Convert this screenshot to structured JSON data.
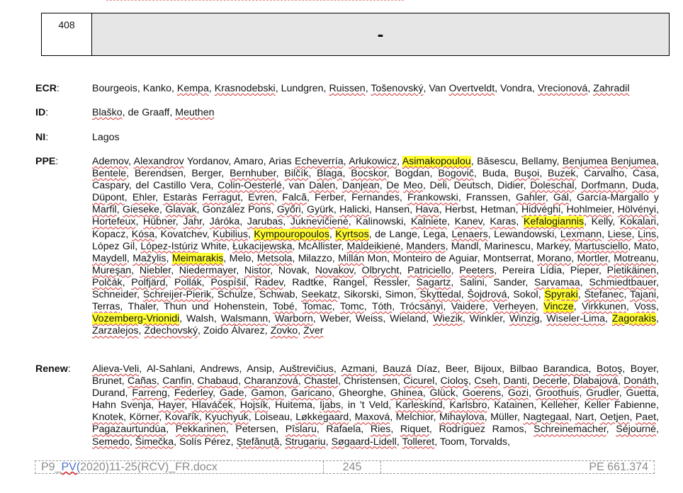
{
  "vote": {
    "number": "408",
    "result": "-"
  },
  "groups": [
    {
      "key": "ecr",
      "label": "ECR",
      "colon": ":",
      "names": "Bourgeois, Kanko, Kempa, Krasnodebski, Lundgren, Ruissen, Tošenovský, Van Overtveldt, Vondra, Vrecionová, Zahradil"
    },
    {
      "key": "id",
      "label": "ID",
      "colon": ":",
      "names": "Blaško, de Graaff, Meuthen"
    },
    {
      "key": "ni",
      "label": "NI",
      "colon": ":",
      "names": "Lagos"
    },
    {
      "key": "ppe",
      "label": "PPE",
      "colon": ":",
      "names": "Ademov, Alexandrov Yordanov, Amaro, Arias Echeverría, Arłukowicz, Asimakopoulou, Băsescu, Bellamy, Benjumea Benjumea, Bentele, Berendsen, Berger, Bernhuber, Bilčík, Blaga, Bocskor, Bogdan, Bogovič, Buda, Buşoi, Buzek, Carvalho, Casa, Caspary, del Castillo Vera, Colin-Oesterlé, van Dalen, Danjean, De Meo, Deli, Deutsch, Didier, Doleschal, Dorfmann, Duda, Düpont, Ehler, Estaràs Ferragut, Evren, Falcă, Ferber, Fernandes, Frankowski, Franssen, Gahler, Gál, García-Margallo y Marfil, Gieseke, Glavak, González Pons, Győri, Gyürk, Halicki, Hansen, Hava, Herbst, Hetman, Hidvéghi, Hohlmeier, Hölvényi, Hortefeux, Hübner, Jahr, Járóka, Jarubas, Juknevičienė, Kalinowski, Kalniete, Kanev, Karas, Kefalogiannis, Kelly, Kokalari, Kopacz, Kósa, Kovatchev, Kubilius, Kympouropoulos, Kyrtsos, de Lange, Lega, Lenaers, Lewandowski, Lexmann, Liese, Lins, López Gil, López-Istúriz White, Łukacijewska, McAllister, Maldeikienė, Manders, Mandl, Marinescu, Markey, Martusciello, Mato, Maydell, Mažylis, Meimarakis, Melo, Metsola, Milazzo, Millán Mon, Monteiro de Aguiar, Montserrat, Morano, Mortler, Motreanu, Mureşan, Niebler, Niedermayer, Nistor, Novak, Novakov, Olbrycht, Patriciello, Peeters, Pereira Lídia, Pieper, Pietikäinen, Polčák, Polfjärd, Pollák, Pospíšil, Radev, Radtke, Rangel, Ressler, Sagartz, Salini, Sander, Sarvamaa, Schmiedtbauer, Schneider, Schreijer-Pierik, Schulze, Schwab, Seekatz, Sikorski, Simon, Skyttedal, Šojdrová, Sokol, Spyraki, Štefanec, Tajani, Terras, Thaler, Thun und Hohenstein, Tobé, Tomac, Tomc, Tóth, Trócsányi, Vaidere, Verheyen, Vincze, Virkkunen, Voss, Vozemberg-Vrionidi, Walsh, Walsmann, Warborn, Weber, Weiss, Wieland, Wiezik, Winkler, Winzig, Wiseler-Lima, Zagorakis, Zarzalejos, Zdechovský, Zoido Álvarez, Zovko, Zver"
    },
    {
      "key": "renew",
      "label": "Renew",
      "colon": ":",
      "names": "Alieva-Veli, Al-Sahlani, Andrews, Ansip, Auštrevičius, Azmani, Bauzá Díaz, Beer, Bijoux, Bilbao Barandica, Botoş, Boyer, Brunet, Cañas, Canfin, Chabaud, Charanzová, Chastel, Christensen, Cicurel, Cioloş, Cseh, Danti, Decerle, Dlabajová, Donáth, Durand, Farreng, Federley, Gade, Gamon, Garicano, Gheorghe, Ghinea, Glück, Goerens, Gozi, Groothuis, Grudler, Guetta, Hahn Svenja, Hayer, Hlaváček, Hojsík, Huitema, Ijabs, in 't Veld, Karleskind, Karlsbro, Katainen, Kelleher, Keller Fabienne, Knotek, Körner, Kovařík, Kyuchyuk, Loiseau, Løkkegaard, Maxová, Melchior, Mihaylova, Müller, Nagtegaal, Nart, Oetjen, Paet, Pagazaurtundúa, Pekkarinen, Petersen, Pîslaru, Rafaela, Ries, Riquet, Rodríguez Ramos, Schreinemacher, Séjourné, Semedo, Šimečka, Solís Pérez, Ştefănuță, Strugariu, Søgaard-Lidell, Tolleret, Toom, Torvalds,"
    }
  ],
  "highlighted_names": [
    "Asimakopoulou",
    "Kefalogiannis",
    "Kympouropoulos",
    "Kyrtsos",
    "Meimarakis",
    "Spyraki",
    "Vincze",
    "Vozemberg-Vrionidi",
    "Zagorakis"
  ],
  "footer": {
    "prefix": "P9_",
    "pv": "PV(",
    "rest": "2020)11-25(RCV)_FR.docx",
    "page": "245",
    "ref": "PE 661.374"
  },
  "colors": {
    "highlight": "#ffff33",
    "spellcheck": "#d32f2f",
    "result_bg": "#e6e6e6"
  }
}
